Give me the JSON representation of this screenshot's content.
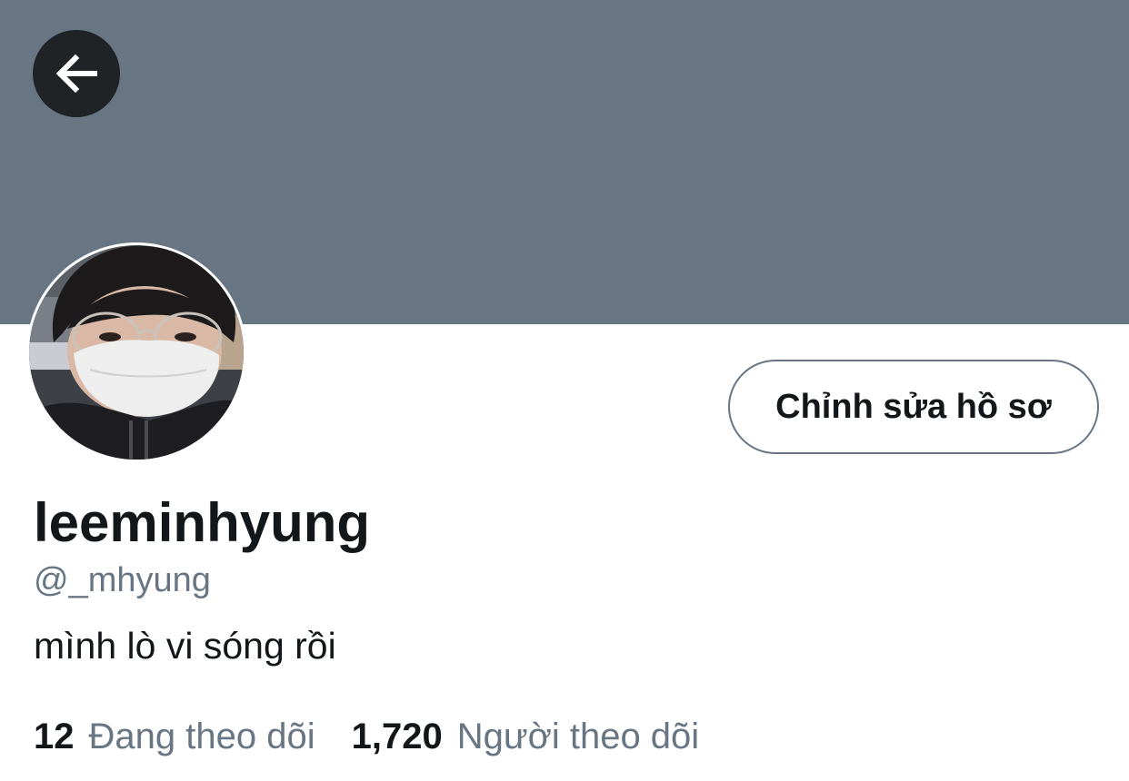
{
  "header": {
    "banner_color": "#687684",
    "back_icon": "arrow-left-icon"
  },
  "profile": {
    "avatar_icon": "profile-photo",
    "edit_button_label": "Chỉnh sửa hồ sơ",
    "display_name": "leeminhyung",
    "handle": "@_mhyung",
    "bio": "mình lò vi sóng rồi"
  },
  "stats": {
    "following_count": "12",
    "following_label": "Đang theo dõi",
    "followers_count": "1,720",
    "followers_label": "Người theo dõi"
  },
  "colors": {
    "text_primary": "#14171a",
    "text_secondary": "#687684",
    "back_button_bg": "#1f2326"
  }
}
